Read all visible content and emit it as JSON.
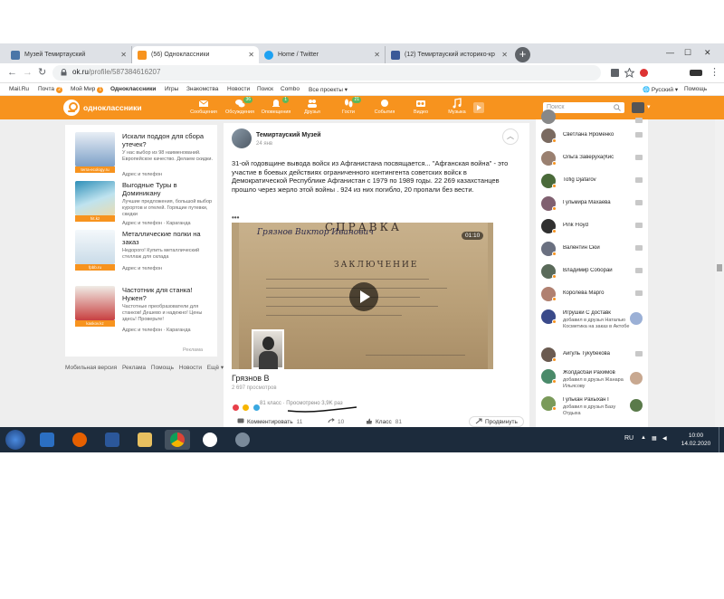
{
  "browser": {
    "tabs": [
      {
        "title": "Музей Темиртауский",
        "color": "#4a76a8"
      },
      {
        "title": "(56) Одноклассники",
        "color": "#f7931e"
      },
      {
        "title": "Home / Twitter",
        "color": "#1da1f2"
      },
      {
        "title": "(12) Темиртауский историко-кр",
        "color": "#3b5998"
      }
    ],
    "url_host": "ok.ru",
    "url_path": "/profile/587384616207",
    "new_tab_symbol": "+"
  },
  "bookmarks": {
    "items": [
      "Mail.Ru",
      "Почта",
      "Мой Мир",
      "Одноклассники",
      "Игры",
      "Знакомства",
      "Новости",
      "Поиск",
      "Combo",
      "Все проекты"
    ],
    "pochta_badge": "2",
    "mymir_badge": "1",
    "language": "Русский",
    "help": "Помощь"
  },
  "ok_header": {
    "logo_text": "одноклассники",
    "nav": [
      {
        "label": "Сообщения",
        "count": ""
      },
      {
        "label": "Обсуждения",
        "count": "36"
      },
      {
        "label": "Оповещения",
        "count": "1"
      },
      {
        "label": "Друзья",
        "count": ""
      },
      {
        "label": "Гости",
        "count": "21"
      },
      {
        "label": "События",
        "count": ""
      },
      {
        "label": "Видео",
        "count": ""
      },
      {
        "label": "Музыка",
        "count": ""
      }
    ],
    "search_placeholder": "Поиск"
  },
  "ads": [
    {
      "title": "Искали поддон для сбора утечек?",
      "desc": "У нас выбор из 98 наименований. Европейское качество. Делаем скидки.",
      "tag": "terra-ecology.ru",
      "addr": "Адрес и телефон",
      "color": "#2d6fb0"
    },
    {
      "title": "Выгодные Туры в Доминикану",
      "desc": "Лучшие предложения, большой выбор курортов и отелей. Горящие путевки, скидки",
      "tag": "hit.kz",
      "addr": "Адрес и телефон · Караганда",
      "color": "#3aa0c0"
    },
    {
      "title": "Металлические полки на заказ",
      "desc": "Недорого! Купить металлический стеллаж для склада",
      "tag": "fpbb.ru",
      "addr": "Адрес и телефон",
      "color": "#d0e4f0"
    },
    {
      "title": "Частотник для станка! Нужен?",
      "desc": "Частотные преобразователи для станков! Дешево и надежно! Цены здесь! Проверьте!",
      "tag": "kaskov.kz",
      "addr": "Адрес и телефон · Караганда",
      "color": "#c03030"
    }
  ],
  "ads_footer": "Реклама",
  "footer_links": [
    "Мобильная версия",
    "Реклама",
    "Помощь",
    "Новости",
    "Ещё ▾"
  ],
  "post": {
    "author": "Темиртауский Музей",
    "date": "24 янв",
    "text": "31-ой годовщине вывода войск из Афганистана посвящается... \"Афганская война\" - это участие в боевых действиях ограниченного контингента советских войск в Демократической Республике Афганистан с 1979 по 1989 годы. 22 269 казахстанцев прошло через жерло этой войны . 924 из них погибло, 20 пропали без вести.",
    "more": "•••",
    "video": {
      "duration": "01:10",
      "doc_heading": "СПРАВКА",
      "doc_name": "Грязнов Виктор Иванович",
      "doc_section": "ЗАКЛЮЧЕНИЕ"
    },
    "video_title": "Грязнов В",
    "views": "2 697 просмотров",
    "reactions_text": "81 класс · Просмотрено 3,9K раз",
    "actions": {
      "comment_label": "Комментировать",
      "comment_count": "11",
      "reshare_count": "10",
      "like_label": "Класс",
      "like_count": "81",
      "share_label": "Продвинуть"
    }
  },
  "friends": [
    {
      "name": "Светлана Яроменко",
      "color": "#7a6a60"
    },
    {
      "name": "Ольга Заверуха(Кис",
      "color": "#9a8070"
    },
    {
      "name": "Tofig Djafarov",
      "color": "#4a6a3a"
    },
    {
      "name": "Гульмира Махаева",
      "color": "#806070"
    },
    {
      "name": "Pink Floyd",
      "color": "#303030"
    },
    {
      "name": "Валентин Сюй",
      "color": "#6a7080"
    },
    {
      "name": "Владимир Соборай",
      "color": "#5a6a5a"
    },
    {
      "name": "Королева Марго",
      "color": "#b08070"
    },
    {
      "name": "Игрушки С доставк",
      "sub": "добавил в друзья Наталью Косметика на заказ в Актобе",
      "color": "#3a4a8a"
    },
    {
      "name": "Айгуль Тукубекова",
      "color": "#6a5a50"
    },
    {
      "name": "Жолдасбай Рахимов",
      "sub": "добавил в друзья Жанара Ильясову",
      "color": "#4a8a6a"
    },
    {
      "name": "Гулькан Рахыхан Г",
      "sub": "добавил в друзья Базу Отдыха",
      "color": "#7a9a5a"
    }
  ],
  "taskbar": {
    "lang": "RU",
    "time": "10:00",
    "date": "14.02.2020"
  }
}
